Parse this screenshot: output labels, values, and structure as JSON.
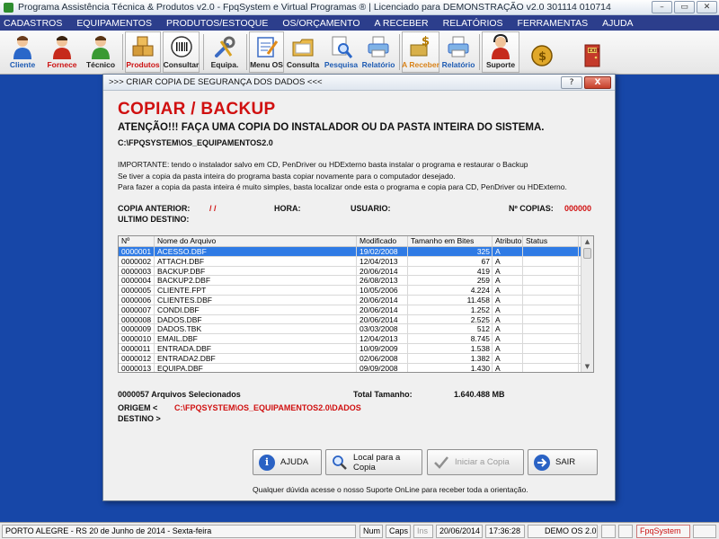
{
  "window": {
    "title": "Programa Assistência Técnica & Produtos v2.0 - FpqSystem e Virtual Programas ® | Licenciado para  DEMONSTRAÇÃO v2.0 301114 010714",
    "min": "–",
    "max": "▭",
    "close": "✕"
  },
  "menu": [
    "CADASTROS",
    "EQUIPAMENTOS",
    "PRODUTOS/ESTOQUE",
    "OS/ORÇAMENTO",
    "A RECEBER",
    "RELATÓRIOS",
    "FERRAMENTAS",
    "AJUDA"
  ],
  "toolbar": {
    "cliente": "Cliente",
    "fornece": "Fornece",
    "tecnico": "Técnico",
    "produtos": "Produtos",
    "consultar": "Consultar",
    "equipa": "Equipa.",
    "menu_os": "Menu OS",
    "consulta": "Consulta",
    "pesquisa": "Pesquisa",
    "relatorio1": "Relatório",
    "a_receber": "A Receber",
    "relatorio2": "Relatório",
    "suporte": "Suporte",
    "exit_label": "EXIT"
  },
  "dialog": {
    "title": ">>> CRIAR COPIA DE SEGURANÇA DOS DADOS <<<",
    "help_btn": "?",
    "close_btn": "X",
    "heading": "COPIAR / BACKUP",
    "warning": "ATENÇÃO!!!  FAÇA UMA COPIA DO INSTALADOR OU DA PASTA INTEIRA DO SISTEMA.",
    "path": "C:\\FPQSYSTEM\\OS_EQUIPAMENTOS2.0",
    "notes": [
      "IMPORTANTE: tendo o instalador salvo em CD, PenDriver ou HDExterno basta instalar o programa e restaurar o Backup",
      "Se tiver a copia da pasta inteira do programa basta copiar novamente para o computador desejado.",
      "Para fazer a copia da pasta inteira é muito simples, basta localizar onde esta o programa e copia para CD, PenDriver ou HDExterno."
    ],
    "info": {
      "copia_anterior_label": "COPIA ANTERIOR:",
      "copia_anterior_value": "/  /",
      "hora_label": "HORA:",
      "usuario_label": "USUARIO:",
      "num_copias_label": "Nº COPIAS:",
      "num_copias_value": "000000",
      "ultimo_destino_label": "ULTIMO DESTINO:"
    },
    "table": {
      "columns": [
        "Nº",
        "Nome do Arquivo",
        "Modificado",
        "Tamanho em Bites",
        "Atributo",
        "Status"
      ],
      "rows": [
        [
          "0000001",
          "ACESSO.DBF",
          "19/02/2008",
          "325",
          "A",
          ""
        ],
        [
          "0000002",
          "ATTACH.DBF",
          "12/04/2013",
          "67",
          "A",
          ""
        ],
        [
          "0000003",
          "BACKUP.DBF",
          "20/06/2014",
          "419",
          "A",
          ""
        ],
        [
          "0000004",
          "BACKUP2.DBF",
          "26/08/2013",
          "259",
          "A",
          ""
        ],
        [
          "0000005",
          "CLIENTE.FPT",
          "10/05/2006",
          "4.224",
          "A",
          ""
        ],
        [
          "0000006",
          "CLIENTES.DBF",
          "20/06/2014",
          "11.458",
          "A",
          ""
        ],
        [
          "0000007",
          "CONDI.DBF",
          "20/06/2014",
          "1.252",
          "A",
          ""
        ],
        [
          "0000008",
          "DADOS.DBF",
          "20/06/2014",
          "2.525",
          "A",
          ""
        ],
        [
          "0000009",
          "DADOS.TBK",
          "03/03/2008",
          "512",
          "A",
          ""
        ],
        [
          "0000010",
          "EMAIL.DBF",
          "12/04/2013",
          "8.745",
          "A",
          ""
        ],
        [
          "0000011",
          "ENTRADA.DBF",
          "10/09/2009",
          "1.538",
          "A",
          ""
        ],
        [
          "0000012",
          "ENTRADA2.DBF",
          "02/06/2008",
          "1.382",
          "A",
          ""
        ],
        [
          "0000013",
          "EQUIPA.DBF",
          "09/09/2008",
          "1.430",
          "A",
          ""
        ]
      ],
      "scroll_up": "▲",
      "scroll_down": "▼"
    },
    "summary": {
      "selected": "0000057 Arquivos Selecionados",
      "total_label": "Total Tamanho:",
      "total_value": "1.640.488 MB",
      "origem_label": "ORIGEM  <",
      "origem_value": "C:\\FPQSYSTEM\\OS_EQUIPAMENTOS2.0\\DADOS",
      "destino_label": "DESTINO >"
    },
    "buttons": {
      "ajuda": "AJUDA",
      "local": "Local para a Copia",
      "iniciar": "Iniciar a Copia",
      "sair": "SAIR"
    },
    "footnote": "Qualquer dúvida acesse o nosso Suporte OnLine para receber toda a orientação."
  },
  "statusbar": {
    "location": "PORTO ALEGRE - RS 20 de Junho de 2014 - Sexta-feira",
    "num": "Num",
    "caps": "Caps",
    "ins": "Ins",
    "date": "20/06/2014",
    "time": "17:36:28",
    "demo": "DEMO OS 2.0",
    "brand": "FpqSystem"
  },
  "colors": {
    "desktop": "#1747a8",
    "menubar": "#2c3e8c",
    "accent_red": "#d01010",
    "selection": "#2f7be5"
  }
}
